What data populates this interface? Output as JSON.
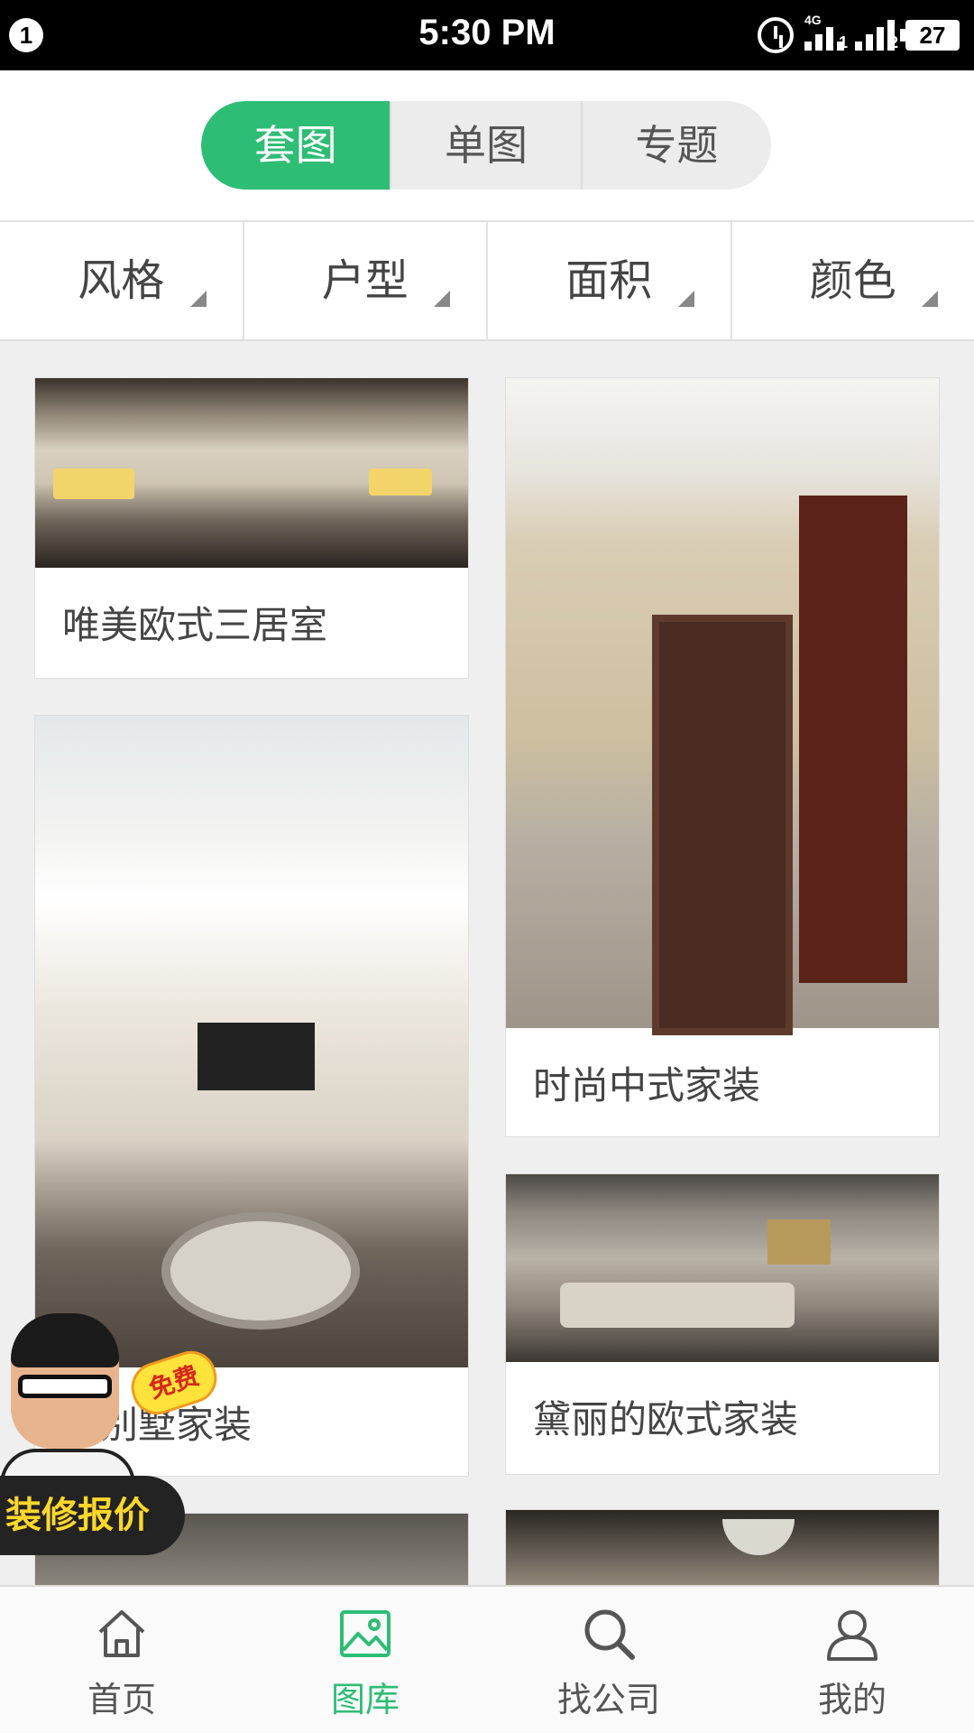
{
  "status_bar": {
    "notification_count": "1",
    "time": "5:30 PM",
    "network_label": "4G",
    "sim1": "1",
    "sim2": "2",
    "battery": "27"
  },
  "segment_tabs": [
    {
      "label": "套图",
      "active": true
    },
    {
      "label": "单图",
      "active": false
    },
    {
      "label": "专题",
      "active": false
    }
  ],
  "filters": [
    {
      "label": "风格"
    },
    {
      "label": "户型"
    },
    {
      "label": "面积"
    },
    {
      "label": "颜色"
    }
  ],
  "gallery": {
    "left_column": [
      {
        "caption": "唯美欧式三居室"
      },
      {
        "caption": "天别墅家装"
      },
      {
        "caption": ""
      }
    ],
    "right_column": [
      {
        "caption": "时尚中式家装"
      },
      {
        "caption": "黛丽的欧式家装"
      },
      {
        "caption": ""
      }
    ]
  },
  "promo": {
    "badge": "免费",
    "label": "装修报价"
  },
  "tab_bar": [
    {
      "label": "首页",
      "icon": "home-icon",
      "active": false
    },
    {
      "label": "图库",
      "icon": "image-icon",
      "active": true
    },
    {
      "label": "找公司",
      "icon": "search-icon",
      "active": false
    },
    {
      "label": "我的",
      "icon": "user-icon",
      "active": false
    }
  ],
  "colors": {
    "accent": "#2dbd75",
    "status_bar": "#000000"
  }
}
